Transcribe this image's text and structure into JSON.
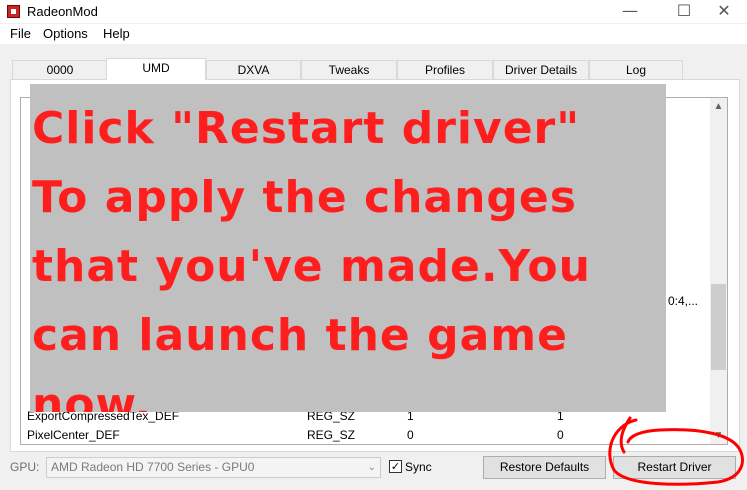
{
  "window": {
    "title": "RadeonMod",
    "minimize": "—",
    "maximize": "☐",
    "close": "✕"
  },
  "menu": [
    "File",
    "Options",
    "Help"
  ],
  "tabs": [
    {
      "label": "0000",
      "active": false
    },
    {
      "label": "UMD",
      "active": true
    },
    {
      "label": "DXVA",
      "active": false
    },
    {
      "label": "Tweaks",
      "active": false
    },
    {
      "label": "Profiles",
      "active": false
    },
    {
      "label": "Driver Details",
      "active": false
    },
    {
      "label": "Log",
      "active": false
    }
  ],
  "registry_rows": [
    {
      "name": "ExportCompressedTex_DEF",
      "type": "REG_SZ",
      "value": "1",
      "default": "1"
    },
    {
      "name": "PixelCenter_DEF",
      "type": "REG_SZ",
      "value": "0",
      "default": "0"
    }
  ],
  "clipped_text": "0:4,...",
  "overlay": {
    "lines": [
      "Click \"Restart driver\"",
      "To apply the changes",
      "that you've made.You",
      "can launch the game",
      "now."
    ],
    "text_color": "#ff1e1e",
    "background": "#c0c0c0"
  },
  "scrollbar": {
    "up": "▲",
    "down": "▼"
  },
  "bottom": {
    "gpu_label": "GPU:",
    "gpu_selected": "AMD Radeon HD 7700 Series - GPU0",
    "gpu_caret": "⌄",
    "sync_checked": true,
    "sync_check_glyph": "✓",
    "sync_label": "Sync",
    "restore_defaults": "Restore Defaults",
    "restart_driver": "Restart Driver"
  },
  "highlight_color": "#ff0000"
}
